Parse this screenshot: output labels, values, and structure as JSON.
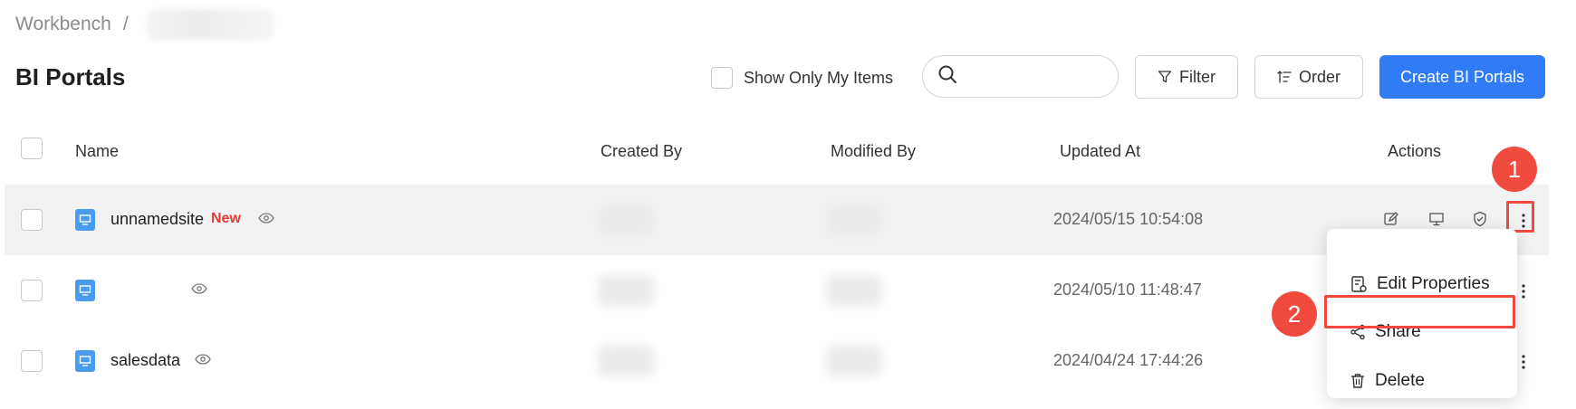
{
  "breadcrumb": {
    "root": "Workbench",
    "separator": "/"
  },
  "page": {
    "title": "BI Portals"
  },
  "toolbar": {
    "show_only_mine_label": "Show Only My Items",
    "search_placeholder": "",
    "filter_label": "Filter",
    "order_label": "Order",
    "create_label": "Create BI Portals"
  },
  "table": {
    "headers": {
      "name": "Name",
      "created_by": "Created By",
      "modified_by": "Modified By",
      "updated_at": "Updated At",
      "actions": "Actions"
    },
    "rows": [
      {
        "name": "unnamedsite",
        "badge": "New",
        "updated_at": "2024/05/15 10:54:08"
      },
      {
        "name": "",
        "badge": "",
        "updated_at": "2024/05/10 11:48:47"
      },
      {
        "name": "salesdata",
        "badge": "",
        "updated_at": "2024/04/24 17:44:26"
      }
    ]
  },
  "context_menu": {
    "items": [
      {
        "label": "Edit Properties",
        "icon": "edit-properties-icon"
      },
      {
        "label": "Share",
        "icon": "share-icon"
      },
      {
        "label": "Delete",
        "icon": "trash-icon"
      }
    ]
  },
  "annotations": {
    "step1": "1",
    "step2": "2"
  },
  "colors": {
    "primary": "#2f7cf6",
    "annotation_red": "#f04a3e",
    "new_badge": "#e53935",
    "portal_icon": "#4a9bf0"
  }
}
